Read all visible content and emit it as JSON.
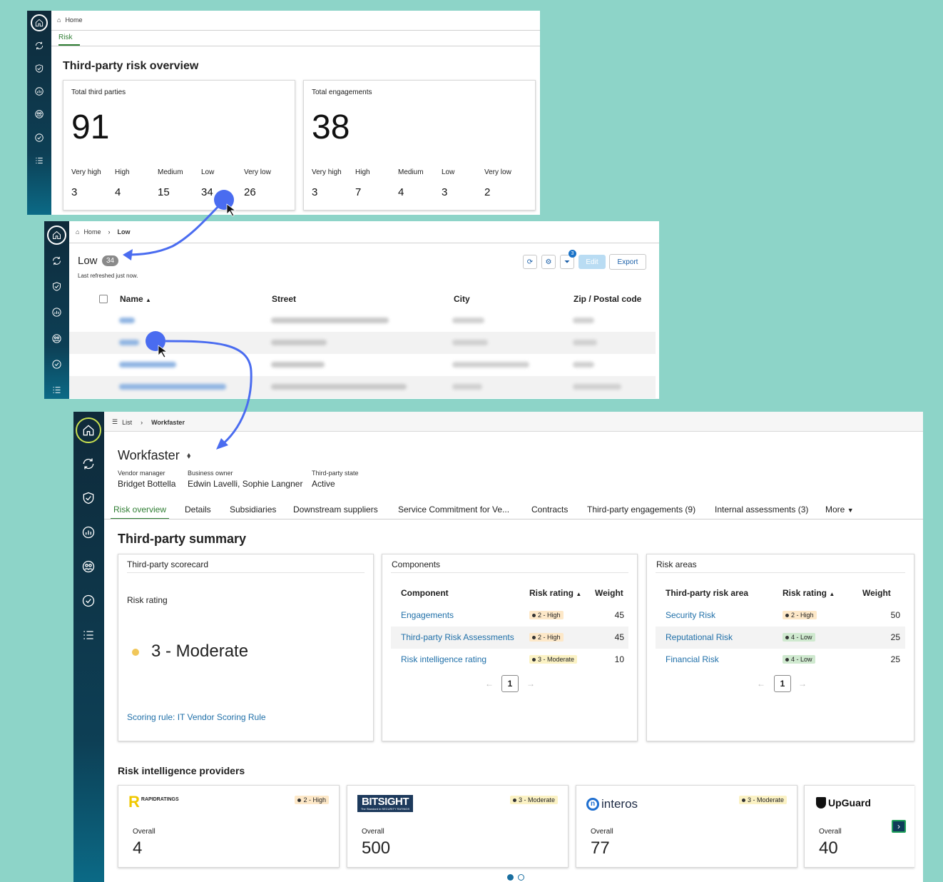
{
  "panel1": {
    "breadcrumb_home": "Home",
    "tab_risk": "Risk",
    "title": "Third-party risk overview",
    "card_parties": {
      "label": "Total third parties",
      "total": "91",
      "levels": [
        {
          "label": "Very high",
          "value": "3"
        },
        {
          "label": "High",
          "value": "4"
        },
        {
          "label": "Medium",
          "value": "15"
        },
        {
          "label": "Low",
          "value": "34"
        },
        {
          "label": "Very low",
          "value": "26"
        }
      ]
    },
    "card_engagements": {
      "label": "Total engagements",
      "total": "38",
      "levels": [
        {
          "label": "Very high",
          "value": "3"
        },
        {
          "label": "High",
          "value": "7"
        },
        {
          "label": "Medium",
          "value": "4"
        },
        {
          "label": "Low",
          "value": "3"
        },
        {
          "label": "Very low",
          "value": "2"
        }
      ]
    }
  },
  "panel2": {
    "breadcrumb_home": "Home",
    "breadcrumb_current": "Low",
    "title": "Low",
    "count": "34",
    "refreshed": "Last refreshed just now.",
    "filter_count": "3",
    "edit_label": "Edit",
    "export_label": "Export",
    "columns": [
      "Name",
      "Street",
      "City",
      "Zip / Postal code"
    ]
  },
  "panel3": {
    "breadcrumb_list": "List",
    "breadcrumb_current": "Workfaster",
    "title": "Workfaster",
    "meta": [
      {
        "label": "Vendor manager",
        "value": "Bridget Bottella"
      },
      {
        "label": "Business owner",
        "value": "Edwin Lavelli, Sophie Langner"
      },
      {
        "label": "Third-party state",
        "value": "Active"
      }
    ],
    "tabs": [
      "Risk overview",
      "Details",
      "Subsidiaries",
      "Downstream suppliers",
      "Service Commitment for Ve...",
      "Contracts",
      "Third-party engagements (9)",
      "Internal assessments (3)",
      "More"
    ],
    "summary_title": "Third-party summary",
    "scorecard": {
      "title": "Third-party scorecard",
      "rating_label": "Risk rating",
      "rating_value": "3 - Moderate",
      "rating_color": "#f1c75a",
      "scoring_rule": "Scoring rule: IT Vendor Scoring Rule"
    },
    "components": {
      "title": "Components",
      "headers": [
        "Component",
        "Risk rating",
        "Weight"
      ],
      "rows": [
        {
          "name": "Engagements",
          "rating": "2 - High",
          "weight": "45"
        },
        {
          "name": "Third-party Risk Assessments",
          "rating": "2 - High",
          "weight": "45"
        },
        {
          "name": "Risk intelligence rating",
          "rating": "3 - Moderate",
          "weight": "10"
        }
      ],
      "page": "1"
    },
    "risk_areas": {
      "title": "Risk areas",
      "headers": [
        "Third-party risk area",
        "Risk rating",
        "Weight"
      ],
      "rows": [
        {
          "name": "Security Risk",
          "rating": "2 - High",
          "weight": "50"
        },
        {
          "name": "Reputational Risk",
          "rating": "4 - Low",
          "weight": "25"
        },
        {
          "name": "Financial Risk",
          "rating": "4 - Low",
          "weight": "25"
        }
      ],
      "page": "1"
    },
    "providers_title": "Risk intelligence providers",
    "providers": [
      {
        "logo": "RAPIDRATINGS",
        "rating": "2 - High",
        "overall_label": "Overall",
        "score": "4"
      },
      {
        "logo": "BITSIGHT",
        "logo_sub": "The Standard in SECURITY RATINGS",
        "rating": "3 - Moderate",
        "overall_label": "Overall",
        "score": "500"
      },
      {
        "logo": "interos",
        "rating": "3 - Moderate",
        "overall_label": "Overall",
        "score": "77"
      },
      {
        "logo": "UpGuard",
        "overall_label": "Overall",
        "score": "40"
      }
    ]
  },
  "colors": {
    "background": "#8dd4c8",
    "accent_green": "#2e7d32",
    "link_blue": "#1f6fa8",
    "arrow_blue": "#4a6cf0"
  }
}
